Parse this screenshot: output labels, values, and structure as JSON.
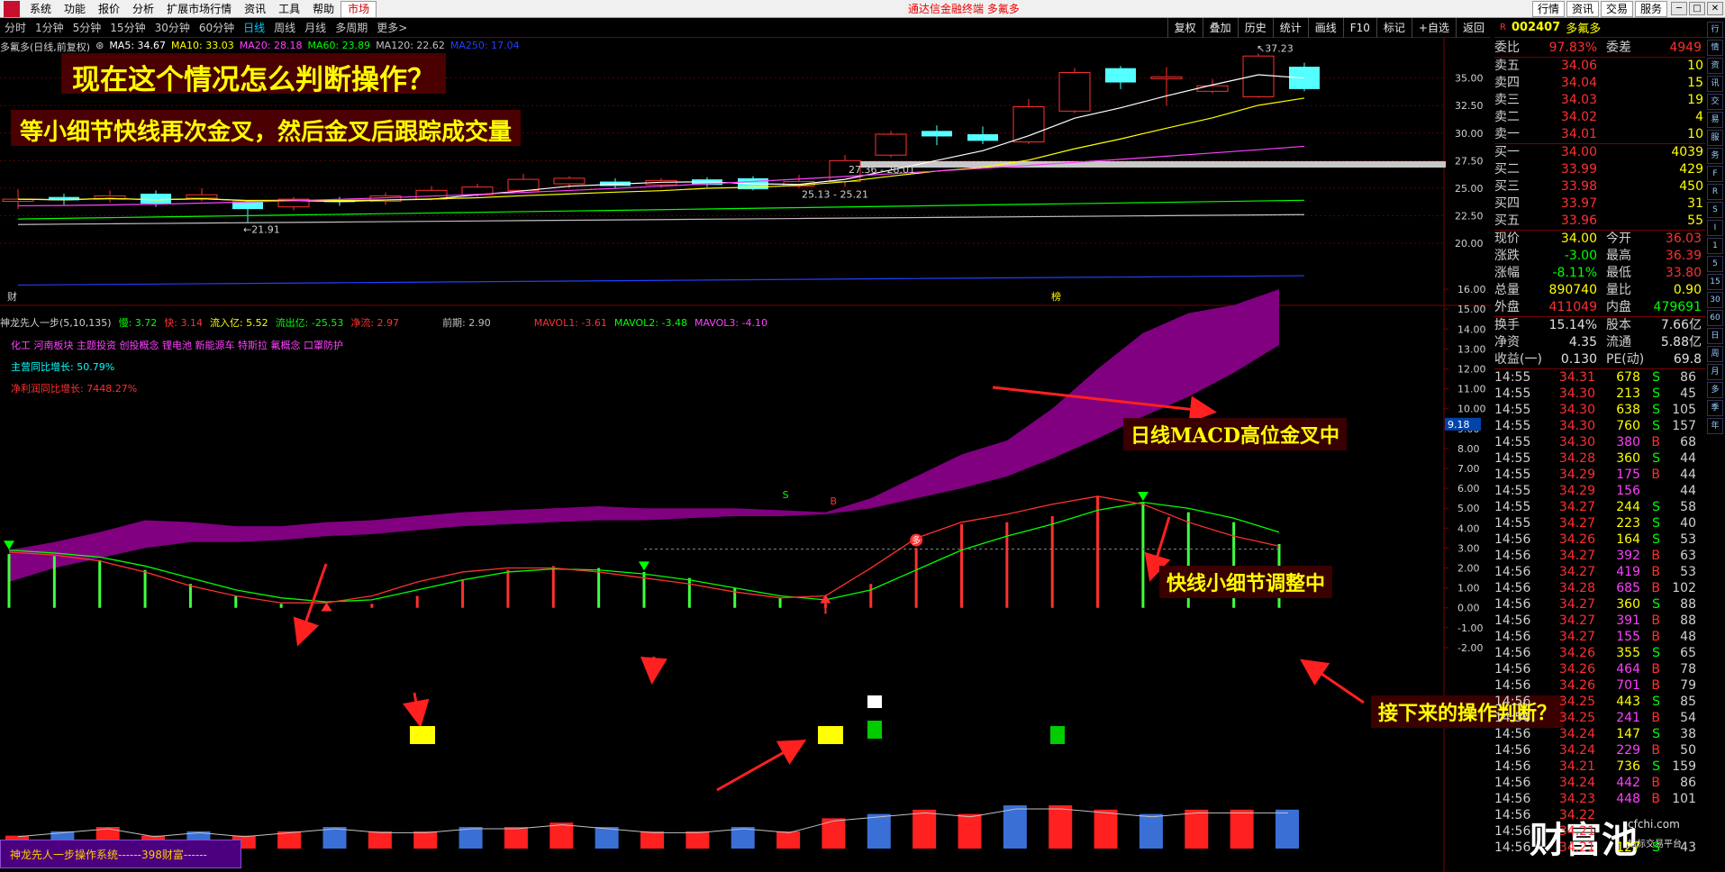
{
  "menubar": {
    "items": [
      "系统",
      "功能",
      "报价",
      "分析",
      "扩展市场行情",
      "资讯",
      "工具",
      "帮助"
    ],
    "active": "市场",
    "center_title": "通达信金融终端 多氟多",
    "right_buttons": [
      "行情",
      "资讯",
      "交易",
      "服务"
    ]
  },
  "periods": {
    "items": [
      "分时",
      "1分钟",
      "5分钟",
      "15分钟",
      "30分钟",
      "60分钟",
      "日线",
      "周线",
      "月线",
      "多周期",
      "更多>"
    ],
    "active_index": 6,
    "tools": [
      "复权",
      "叠加",
      "历史",
      "统计",
      "画线",
      "F10",
      "标记",
      "+自选",
      "返回"
    ]
  },
  "stock": {
    "code": "002407",
    "name": "多氟多",
    "market_flag": "R"
  },
  "kline": {
    "title": "多氟多(日线,前复权)",
    "ma_values": [
      {
        "label": "MA5: 34.67",
        "color": "#ffffff"
      },
      {
        "label": "MA10: 33.03",
        "color": "#ffff00"
      },
      {
        "label": "MA20: 28.18",
        "color": "#ff40ff"
      },
      {
        "label": "MA60: 23.89",
        "color": "#00ff00"
      },
      {
        "label": "MA120: 22.62",
        "color": "#c0c0c0"
      },
      {
        "label": "MA250: 17.04",
        "color": "#2040ff"
      }
    ],
    "price_ticks": [
      "35.00",
      "32.50",
      "30.00",
      "27.50",
      "25.00",
      "22.50",
      "20.00"
    ],
    "annotations": {
      "high": "37.23",
      "low": "21.91",
      "range1": "27.36 - 28.01",
      "range2": "25.13 - 25.21"
    },
    "markers": {
      "left": "财",
      "mid": "榜"
    }
  },
  "sub": {
    "title": "神龙先人一步(5,10,135)",
    "values": [
      {
        "label": "慢: 3.72",
        "color": "#00ff00"
      },
      {
        "label": "快: 3.14",
        "color": "#ff3030"
      },
      {
        "label": "流入亿: 5.52",
        "color": "#ffff00"
      },
      {
        "label": "流出亿: -25.53",
        "color": "#00ff00"
      },
      {
        "label": "净流: 2.97",
        "color": "#ff3030"
      },
      {
        "label": "前期: 2.90",
        "color": "#c0c0c0"
      },
      {
        "label": "MAVOL1: -3.61",
        "color": "#ff3030"
      },
      {
        "label": "MAVOL2: -3.48",
        "color": "#00ff00"
      },
      {
        "label": "MAVOL3: -4.10",
        "color": "#ff40ff"
      }
    ],
    "concepts": "化工 河南板块 主题投资 创投概念 锂电池 新能源车 特斯拉 氟概念 口罩防护",
    "revenue_growth": "主营同比增长: 50.79%",
    "profit_growth": "净利润同比增长: 7448.27%",
    "ticks": [
      "16.00",
      "15.00",
      "14.00",
      "13.00",
      "12.00",
      "11.00",
      "10.00",
      "9.00",
      "8.00",
      "7.00",
      "6.00",
      "5.00",
      "4.00",
      "3.00",
      "2.00",
      "1.00",
      "0.00",
      "-1.00",
      "-2.00"
    ],
    "current_tag": "9.18",
    "signals": {
      "s": "S",
      "b": "B",
      "duo": "多"
    }
  },
  "overlay": {
    "headline": "现在这个情况怎么判断操作？",
    "subheadline": "等小细节快线再次金叉，然后金叉后跟踪成交量",
    "note1": "日线MACD高位金叉中",
    "note2": "快线小细节调整中",
    "note3": "接下来的操作判断？"
  },
  "footer": {
    "tab": "神龙先人一步操作系统------398财富------"
  },
  "watermark": {
    "brand": "财富池",
    "site": "cfchi.com",
    "slogan": "指标交易平台"
  },
  "orderbook": {
    "ratio": {
      "l1": "委比",
      "v1": "97.83%",
      "l2": "委差",
      "v2": "4949"
    },
    "asks": [
      {
        "label": "卖五",
        "price": "34.06",
        "vol": "10"
      },
      {
        "label": "卖四",
        "price": "34.04",
        "vol": "15"
      },
      {
        "label": "卖三",
        "price": "34.03",
        "vol": "19"
      },
      {
        "label": "卖二",
        "price": "34.02",
        "vol": "4"
      },
      {
        "label": "卖一",
        "price": "34.01",
        "vol": "10"
      }
    ],
    "bids": [
      {
        "label": "买一",
        "price": "34.00",
        "vol": "4039"
      },
      {
        "label": "买二",
        "price": "33.99",
        "vol": "429"
      },
      {
        "label": "买三",
        "price": "33.98",
        "vol": "450"
      },
      {
        "label": "买四",
        "price": "33.97",
        "vol": "31"
      },
      {
        "label": "买五",
        "price": "33.96",
        "vol": "55"
      }
    ]
  },
  "stats": [
    {
      "l1": "现价",
      "v1": "34.00",
      "c1": "#ffff00",
      "l2": "今开",
      "v2": "36.03",
      "c2": "#ff3030"
    },
    {
      "l1": "涨跌",
      "v1": "-3.00",
      "c1": "#00ff00",
      "l2": "最高",
      "v2": "36.39",
      "c2": "#ff3030"
    },
    {
      "l1": "涨幅",
      "v1": "-8.11%",
      "c1": "#00ff00",
      "l2": "最低",
      "v2": "33.80",
      "c2": "#ff3030"
    },
    {
      "l1": "总量",
      "v1": "890740",
      "c1": "#ffff00",
      "l2": "量比",
      "v2": "0.90",
      "c2": "#ffff00"
    },
    {
      "l1": "外盘",
      "v1": "411049",
      "c1": "#ff3030",
      "l2": "内盘",
      "v2": "479691",
      "c2": "#00ff00"
    }
  ],
  "fin": [
    {
      "l1": "换手",
      "v1": "15.14%",
      "l2": "股本",
      "v2": "7.66亿"
    },
    {
      "l1": "净资",
      "v1": "4.35",
      "l2": "流通",
      "v2": "5.88亿"
    },
    {
      "l1": "收益(一)",
      "v1": "0.130",
      "l2": "PE(动)",
      "v2": "69.8"
    }
  ],
  "ticks": [
    {
      "t": "14:55",
      "p": "34.31",
      "v": "678",
      "d": "S",
      "n": "86"
    },
    {
      "t": "14:55",
      "p": "34.30",
      "v": "213",
      "d": "S",
      "n": "45"
    },
    {
      "t": "14:55",
      "p": "34.30",
      "v": "638",
      "d": "S",
      "n": "105"
    },
    {
      "t": "14:55",
      "p": "34.30",
      "v": "760",
      "d": "S",
      "n": "157"
    },
    {
      "t": "14:55",
      "p": "34.30",
      "v": "380",
      "d": "B",
      "n": "68"
    },
    {
      "t": "14:55",
      "p": "34.28",
      "v": "360",
      "d": "S",
      "n": "44"
    },
    {
      "t": "14:55",
      "p": "34.29",
      "v": "175",
      "d": "B",
      "n": "44"
    },
    {
      "t": "14:55",
      "p": "34.29",
      "v": "156",
      "d": "",
      "n": "44"
    },
    {
      "t": "14:55",
      "p": "34.27",
      "v": "244",
      "d": "S",
      "n": "58"
    },
    {
      "t": "14:55",
      "p": "34.27",
      "v": "223",
      "d": "S",
      "n": "40"
    },
    {
      "t": "14:56",
      "p": "34.26",
      "v": "164",
      "d": "S",
      "n": "53"
    },
    {
      "t": "14:56",
      "p": "34.27",
      "v": "392",
      "d": "B",
      "n": "63"
    },
    {
      "t": "14:56",
      "p": "34.27",
      "v": "419",
      "d": "B",
      "n": "53"
    },
    {
      "t": "14:56",
      "p": "34.28",
      "v": "685",
      "d": "B",
      "n": "102"
    },
    {
      "t": "14:56",
      "p": "34.27",
      "v": "360",
      "d": "S",
      "n": "88"
    },
    {
      "t": "14:56",
      "p": "34.27",
      "v": "391",
      "d": "B",
      "n": "88"
    },
    {
      "t": "14:56",
      "p": "34.27",
      "v": "155",
      "d": "B",
      "n": "48"
    },
    {
      "t": "14:56",
      "p": "34.26",
      "v": "355",
      "d": "S",
      "n": "65"
    },
    {
      "t": "14:56",
      "p": "34.26",
      "v": "464",
      "d": "B",
      "n": "78"
    },
    {
      "t": "14:56",
      "p": "34.26",
      "v": "701",
      "d": "B",
      "n": "79"
    },
    {
      "t": "14:56",
      "p": "34.25",
      "v": "443",
      "d": "S",
      "n": "85"
    },
    {
      "t": "14:56",
      "p": "34.25",
      "v": "241",
      "d": "B",
      "n": "54"
    },
    {
      "t": "14:56",
      "p": "34.24",
      "v": "147",
      "d": "S",
      "n": "38"
    },
    {
      "t": "14:56",
      "p": "34.24",
      "v": "229",
      "d": "B",
      "n": "50"
    },
    {
      "t": "14:56",
      "p": "34.21",
      "v": "736",
      "d": "S",
      "n": "159"
    },
    {
      "t": "14:56",
      "p": "34.24",
      "v": "442",
      "d": "B",
      "n": "86"
    },
    {
      "t": "14:56",
      "p": "34.23",
      "v": "448",
      "d": "B",
      "n": "101"
    },
    {
      "t": "14:56",
      "p": "34.22",
      "v": "",
      "d": "",
      "n": ""
    },
    {
      "t": "14:56",
      "p": "34.21",
      "v": "",
      "d": "",
      "n": ""
    },
    {
      "t": "14:56",
      "p": "34.21",
      "v": "127",
      "d": "S",
      "n": "43"
    }
  ],
  "side_icons": [
    "行",
    "情",
    "资",
    "讯",
    "交",
    "易",
    "服",
    "务",
    "F",
    "R",
    "S",
    "I",
    "1",
    "5",
    "15",
    "30",
    "60",
    "日",
    "周",
    "月",
    "多",
    "季",
    "年"
  ],
  "chart_data": {
    "type": "candlestick",
    "candles": [
      {
        "o": 23.8,
        "c": 24.0,
        "h": 24.9,
        "l": 23.1
      },
      {
        "o": 24.2,
        "c": 23.9,
        "h": 24.5,
        "l": 23.5
      },
      {
        "o": 24.0,
        "c": 24.3,
        "h": 24.8,
        "l": 23.7
      },
      {
        "o": 24.5,
        "c": 23.6,
        "h": 24.8,
        "l": 23.3
      },
      {
        "o": 24.1,
        "c": 24.4,
        "h": 25.0,
        "l": 23.8
      },
      {
        "o": 23.8,
        "c": 23.1,
        "h": 23.9,
        "l": 21.91
      },
      {
        "o": 23.3,
        "c": 24.0,
        "h": 24.2,
        "l": 23.0
      },
      {
        "o": 23.9,
        "c": 23.8,
        "h": 24.2,
        "l": 23.4
      },
      {
        "o": 23.8,
        "c": 24.3,
        "h": 24.6,
        "l": 23.5
      },
      {
        "o": 24.0,
        "c": 24.8,
        "h": 25.2,
        "l": 23.9
      },
      {
        "o": 24.4,
        "c": 25.1,
        "h": 25.4,
        "l": 24.2
      },
      {
        "o": 24.8,
        "c": 25.8,
        "h": 26.3,
        "l": 24.6
      },
      {
        "o": 25.4,
        "c": 25.9,
        "h": 26.1,
        "l": 25.0
      },
      {
        "o": 25.6,
        "c": 25.2,
        "h": 25.9,
        "l": 25.0
      },
      {
        "o": 25.3,
        "c": 25.7,
        "h": 25.9,
        "l": 25.0
      },
      {
        "o": 25.8,
        "c": 25.3,
        "h": 26.0,
        "l": 25.1
      },
      {
        "o": 25.9,
        "c": 24.9,
        "h": 26.1,
        "l": 24.8
      },
      {
        "o": 25.2,
        "c": 25.6,
        "h": 26.2,
        "l": 25.0
      },
      {
        "o": 25.6,
        "c": 27.5,
        "h": 28.01,
        "l": 25.13
      },
      {
        "o": 28.0,
        "c": 29.9,
        "h": 30.2,
        "l": 27.8
      },
      {
        "o": 30.2,
        "c": 29.7,
        "h": 30.7,
        "l": 28.9
      },
      {
        "o": 29.9,
        "c": 29.3,
        "h": 30.6,
        "l": 29.0
      },
      {
        "o": 29.2,
        "c": 32.4,
        "h": 33.1,
        "l": 29.0
      },
      {
        "o": 32.0,
        "c": 35.5,
        "h": 35.9,
        "l": 31.8
      },
      {
        "o": 35.9,
        "c": 34.6,
        "h": 36.1,
        "l": 34.0
      },
      {
        "o": 35.0,
        "c": 35.1,
        "h": 36.0,
        "l": 32.5
      },
      {
        "o": 33.8,
        "c": 34.3,
        "h": 34.9,
        "l": 33.6
      },
      {
        "o": 33.3,
        "c": 37.0,
        "h": 37.23,
        "l": 33.2
      },
      {
        "o": 36.03,
        "c": 34.0,
        "h": 36.39,
        "l": 33.8
      }
    ]
  }
}
